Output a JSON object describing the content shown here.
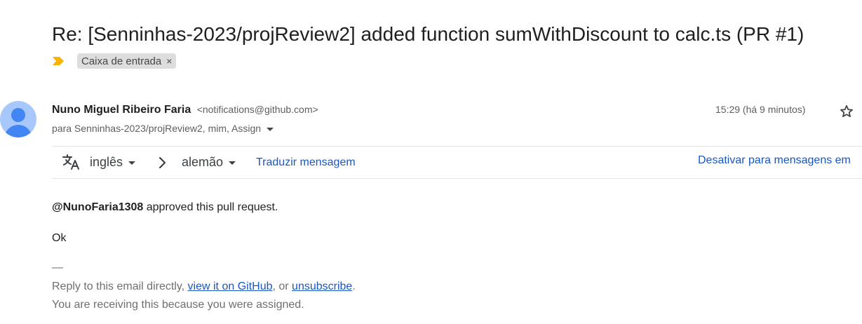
{
  "email": {
    "subject": "Re: [Senninhas-2023/projReview2] added function sumWithDiscount to calc.ts (PR #1)",
    "importance_icon": "importance-marker-icon",
    "importance_color": "#f4b400",
    "label": {
      "text": "Caixa de entrada",
      "remove_symbol": "×"
    },
    "sender": {
      "name": "Nuno Miguel Ribeiro Faria",
      "email": "<notifications@github.com>",
      "to_line": "para Senninhas-2023/projReview2, mim, Assign"
    },
    "time": "15:29 (há 9 minutos)",
    "star_icon": "star-outline-icon"
  },
  "translation": {
    "icon": "translate-icon",
    "from_language": "inglês",
    "to_language": "alemão",
    "translate_link": "Traduzir mensagem",
    "disable_link": "Desativar para mensagens em"
  },
  "body": {
    "mention": "@NunoFaria1308",
    "approval_text": " approved this pull request.",
    "message": "Ok",
    "separator": "—",
    "footer_reply_prefix": "Reply to this email directly, ",
    "view_link": "view it on GitHub",
    "footer_or": ", or ",
    "unsubscribe_link": "unsubscribe",
    "footer_period": ".",
    "footer_reason": "You are receiving this because you were assigned."
  },
  "colors": {
    "link": "#1a56c2",
    "avatar_bg": "#a8c7fa",
    "avatar_fg": "#4285f4",
    "label_chip_bg": "#dddddd"
  }
}
